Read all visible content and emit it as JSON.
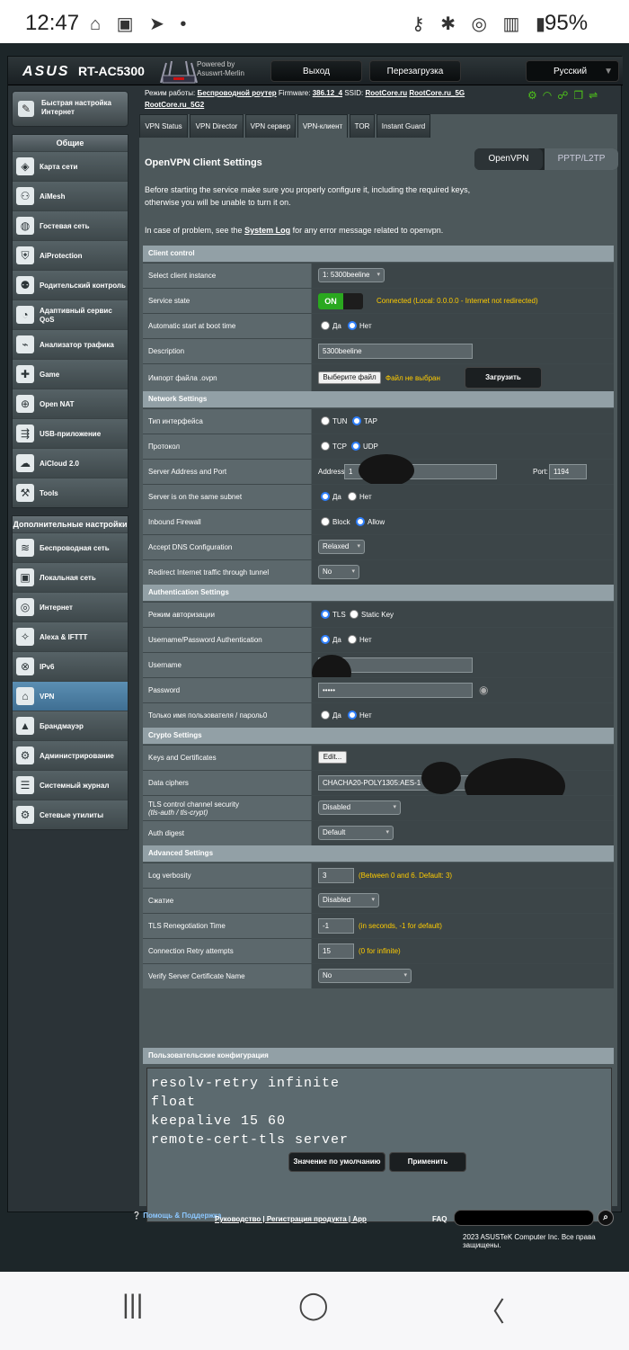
{
  "status_bar": {
    "time": "12:47",
    "left_icons": "⌂ ▣ ➤ •",
    "right_icons": "⚷ ✱ ◎ ▥ ▮",
    "battery": "95%"
  },
  "header": {
    "logo": "ASUS",
    "model": "RT-AC5300",
    "powered_by": "Powered by",
    "firmware_brand": "Asuswrt-Merlin",
    "logout": "Выход",
    "reboot": "Перезагрузка",
    "language": "Русский"
  },
  "info": {
    "mode_label": "Режим работы:",
    "mode_value": "Беспроводной роутер",
    "firmware_label": "Firmware:",
    "firmware_value": "386.12_4",
    "ssid_label": "SSID:",
    "ssid1": "RootCore.ru",
    "ssid2": "RootCore.ru_5G",
    "ssid3": "RootCore.ru_5G2"
  },
  "sidebar": {
    "quick_setup": "Быстрая настройка Интернет",
    "general_header": "Общие",
    "general": [
      {
        "label": "Карта сети",
        "icon": "network-map-icon"
      },
      {
        "label": "AiMesh",
        "icon": "aimesh-icon"
      },
      {
        "label": "Гостевая сеть",
        "icon": "guest-network-icon"
      },
      {
        "label": "AiProtection",
        "icon": "aiprotection-icon"
      },
      {
        "label": "Родительский контроль",
        "icon": "parental-control-icon"
      },
      {
        "label": "Адаптивный сервис QoS",
        "icon": "qos-icon"
      },
      {
        "label": "Анализатор трафика",
        "icon": "traffic-analyzer-icon"
      },
      {
        "label": "Game",
        "icon": "game-icon"
      },
      {
        "label": "Open NAT",
        "icon": "open-nat-icon"
      },
      {
        "label": "USB-приложение",
        "icon": "usb-icon"
      },
      {
        "label": "AiCloud 2.0",
        "icon": "aicloud-icon"
      },
      {
        "label": "Tools",
        "icon": "tools-icon"
      }
    ],
    "advanced_header": "Дополнительные настройки",
    "advanced": [
      {
        "label": "Беспроводная сеть",
        "icon": "wireless-icon"
      },
      {
        "label": "Локальная сеть",
        "icon": "lan-icon"
      },
      {
        "label": "Интернет",
        "icon": "wan-icon"
      },
      {
        "label": "Alexa & IFTTT",
        "icon": "alexa-icon"
      },
      {
        "label": "IPv6",
        "icon": "ipv6-icon"
      },
      {
        "label": "VPN",
        "icon": "vpn-icon"
      },
      {
        "label": "Брандмауэр",
        "icon": "firewall-icon"
      },
      {
        "label": "Администрирование",
        "icon": "admin-icon"
      },
      {
        "label": "Системный журнал",
        "icon": "syslog-icon"
      },
      {
        "label": "Сетевые утилиты",
        "icon": "network-tools-icon"
      }
    ]
  },
  "tabs": [
    "VPN Status",
    "VPN Director",
    "VPN сервер",
    "VPN-клиент",
    "TOR",
    "Instant Guard"
  ],
  "content": {
    "title": "OpenVPN Client Settings",
    "switch_openvpn": "OpenVPN",
    "switch_pptp": "PPTP/L2TP",
    "desc1": "Before starting the service make sure you properly configure it, including the required keys,",
    "desc2": "otherwise you will be unable to turn it on.",
    "desc3_pre": "In case of problem, see the",
    "desc3_link": "System Log",
    "desc3_post": "for any error message related to openvpn."
  },
  "client_control": {
    "header": "Client control",
    "select_instance": "Select client instance",
    "instance_value": "1: 5300beeline",
    "service_state": "Service state",
    "on": "ON",
    "connected_note": "Connected (Local: 0.0.0.0 - Internet not redirected)",
    "autostart": "Automatic start at boot time",
    "yes": "Да",
    "no": "Нет",
    "description": "Description",
    "description_value": "5300beeline",
    "import": "Импорт файла .ovpn",
    "choose_file": "Выберите файл",
    "no_file": "Файл не выбран",
    "upload": "Загрузить"
  },
  "network": {
    "header": "Network Settings",
    "iface": "Тип интерфейса",
    "tun": "TUN",
    "tap": "TAP",
    "proto": "Протокол",
    "tcp": "TCP",
    "udp": "UDP",
    "server": "Server Address and Port",
    "address_label": "Address:",
    "address_value": "1",
    "port_label": "Port:",
    "port_value": "1194",
    "subnet": "Server is on the same subnet",
    "inbound": "Inbound Firewall",
    "block": "Block",
    "allow": "Allow",
    "dns": "Accept DNS Configuration",
    "dns_value": "Relaxed",
    "redirect": "Redirect Internet traffic through tunnel",
    "redirect_value": "No"
  },
  "auth": {
    "header": "Authentication Settings",
    "mode": "Режим авторизации",
    "tls": "TLS",
    "static": "Static Key",
    "userpass": "Username/Password Authentication",
    "username": "Username",
    "password": "Password",
    "password_value": "•••••",
    "user_only": "Только имя пользователя / пароль0"
  },
  "crypto": {
    "header": "Crypto Settings",
    "keys": "Keys and Certificates",
    "edit": "Edit...",
    "ciphers": "Data ciphers",
    "ciphers_value": "CHACHA20-POLY1305:AES-1",
    "tls_sec": "TLS control channel security",
    "tls_sec_sub": "(tls-auth / tls-crypt)",
    "tls_sec_value": "Disabled",
    "digest": "Auth digest",
    "digest_value": "Default"
  },
  "advanced": {
    "header": "Advanced Settings",
    "verbosity": "Log verbosity",
    "verbosity_value": "3",
    "verbosity_note": "(Between 0 and 6. Default: 3)",
    "compress": "Сжатие",
    "compress_value": "Disabled",
    "reneg": "TLS Renegotiation Time",
    "reneg_value": "-1",
    "reneg_note": "(in seconds, -1 for default)",
    "retry": "Connection Retry attempts",
    "retry_value": "15",
    "retry_note": "(0 for infinite)",
    "verify": "Verify Server Certificate Name",
    "verify_value": "No"
  },
  "custom": {
    "header": "Пользовательские конфигурация",
    "text": "resolv-retry infinite\nfloat\nkeepalive 15 60\nremote-cert-tls server"
  },
  "buttons": {
    "default": "Значение по умолчанию",
    "apply": "Применить"
  },
  "footer": {
    "help": "Помощь & Поддержка",
    "links": "Руководство | Регистрация продукта | App",
    "faq": "FAQ",
    "copyright": "2023 ASUSTeK Computer Inc. Все права защищены."
  },
  "navbar": {
    "recent": "|||",
    "home": "◯",
    "back": "〈"
  }
}
